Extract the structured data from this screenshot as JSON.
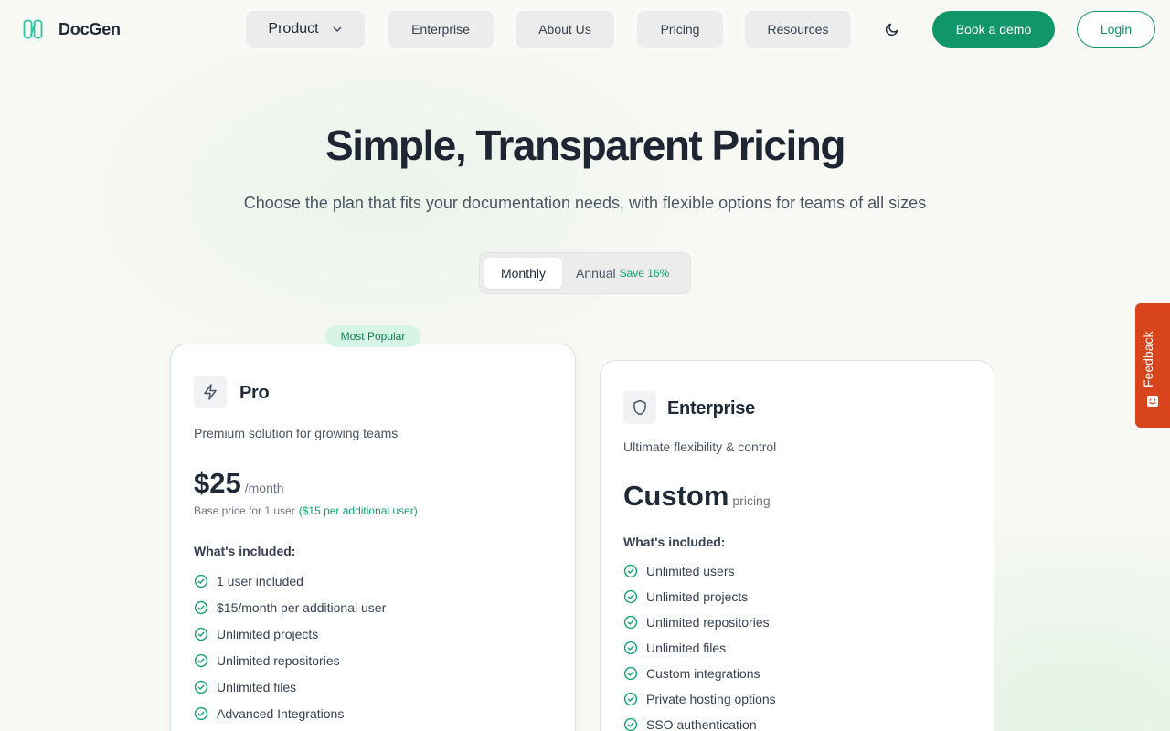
{
  "brand": {
    "name": "DocGen"
  },
  "nav": {
    "product": "Product",
    "enterprise": "Enterprise",
    "about": "About Us",
    "pricing": "Pricing",
    "resources": "Resources",
    "book_demo": "Book a demo",
    "login": "Login"
  },
  "hero": {
    "title": "Simple, Transparent Pricing",
    "subtitle": "Choose the plan that fits your documentation needs, with flexible options for teams of all sizes"
  },
  "billing": {
    "monthly": "Monthly",
    "annual": "Annual",
    "save": "Save 16%",
    "selected": "Monthly"
  },
  "plans": {
    "pro": {
      "badge": "Most Popular",
      "name": "Pro",
      "icon": "lightning-icon",
      "description": "Premium solution for growing teams",
      "price": "$25",
      "period": "/month",
      "note": "Base price for 1 user",
      "note_accent": "($15 per additional user)",
      "included_label": "What's included:",
      "features": [
        "1 user included",
        "$15/month per additional user",
        "Unlimited projects",
        "Unlimited repositories",
        "Unlimited files",
        "Advanced Integrations"
      ]
    },
    "enterprise": {
      "name": "Enterprise",
      "icon": "shield-icon",
      "description": "Ultimate flexibility & control",
      "price": "Custom",
      "period": "pricing",
      "included_label": "What's included:",
      "features": [
        "Unlimited users",
        "Unlimited projects",
        "Unlimited repositories",
        "Unlimited files",
        "Custom integrations",
        "Private hosting options",
        "SSO authentication"
      ]
    }
  },
  "feedback": {
    "label": "Feedback"
  },
  "colors": {
    "accent": "#119669",
    "accent_text": "#10a36f",
    "feedback": "#d8451c",
    "background": "#f8f8f5"
  }
}
